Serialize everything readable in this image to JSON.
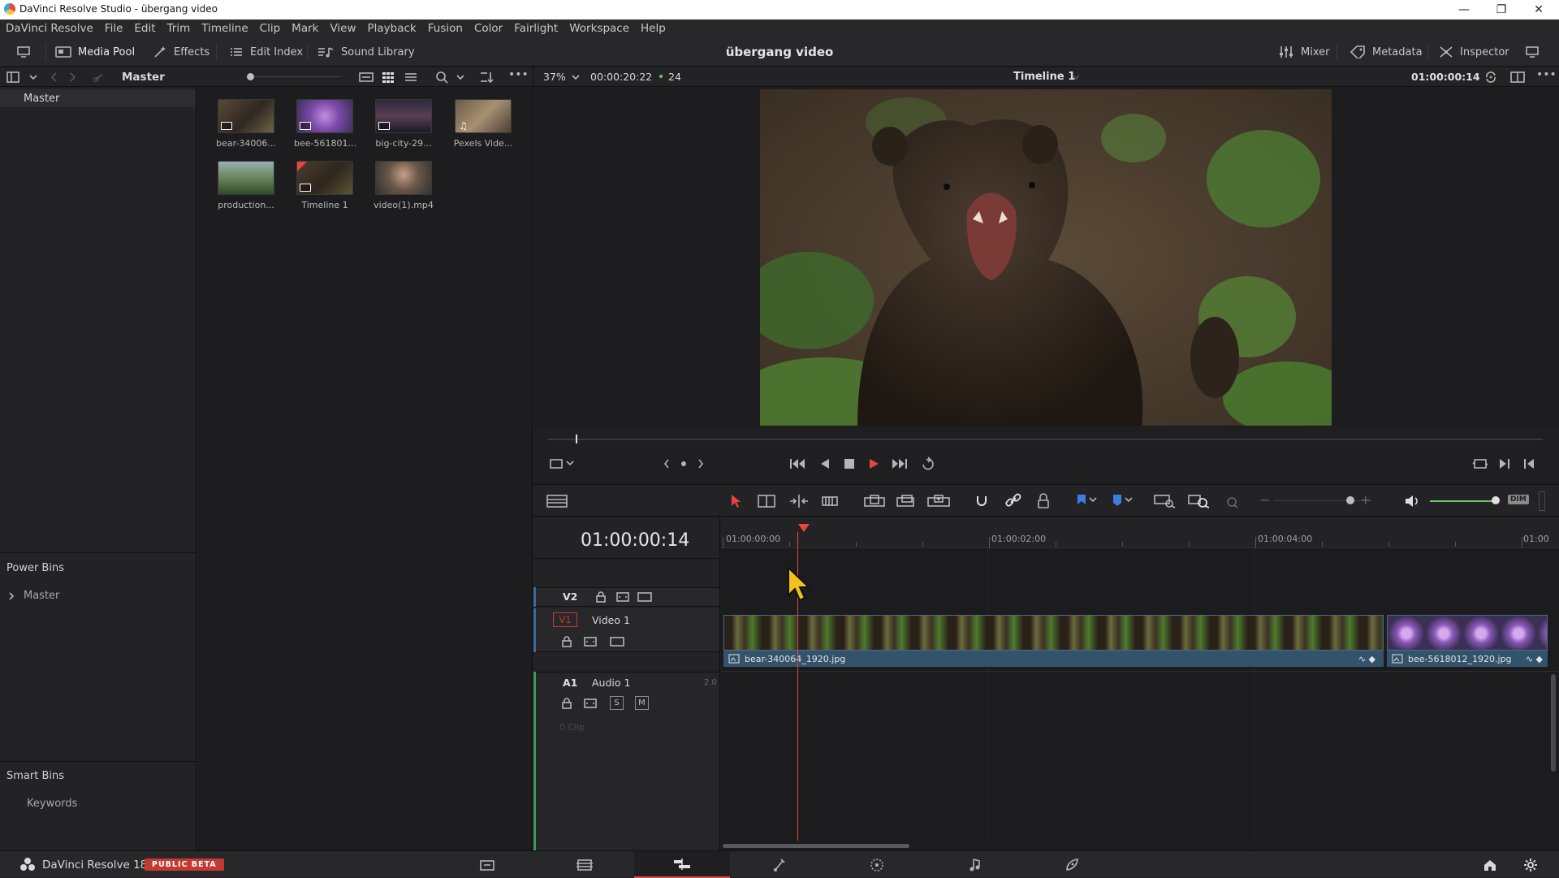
{
  "window": {
    "title": "DaVinci Resolve Studio - übergang video"
  },
  "menu": [
    "DaVinci Resolve",
    "File",
    "Edit",
    "Trim",
    "Timeline",
    "Clip",
    "Mark",
    "View",
    "Playback",
    "Fusion",
    "Color",
    "Fairlight",
    "Workspace",
    "Help"
  ],
  "toolbar": {
    "media_pool": "Media Pool",
    "effects": "Effects",
    "edit_index": "Edit Index",
    "sound_library": "Sound Library",
    "project_title": "übergang video",
    "mixer": "Mixer",
    "metadata": "Metadata",
    "inspector": "Inspector"
  },
  "subbar": {
    "bin": "Master",
    "zoom": "37%",
    "source_timecode": "00:00:20:22",
    "fps": "24",
    "timeline_name": "Timeline 1",
    "record_timecode": "01:00:00:14"
  },
  "left_panel": {
    "master": "Master",
    "power_bins": "Power Bins",
    "power_master": "Master",
    "smart_bins": "Smart Bins",
    "keywords": "Keywords"
  },
  "media_pool": {
    "clips": [
      {
        "name": "bear-34006...",
        "kind": "image"
      },
      {
        "name": "bee-561801...",
        "kind": "image"
      },
      {
        "name": "big-city-29...",
        "kind": "image"
      },
      {
        "name": "Pexels Vide...",
        "kind": "audio"
      },
      {
        "name": "production...",
        "kind": "video"
      },
      {
        "name": "Timeline 1",
        "kind": "timeline"
      },
      {
        "name": "video(1).mp4",
        "kind": "video"
      }
    ]
  },
  "timeline": {
    "timecode": "01:00:00:14",
    "ruler": [
      "01:00:00:00",
      "01:00:02:00",
      "01:00:04:00",
      "01:00"
    ],
    "tracks": {
      "v2": "V2",
      "v1": "V1",
      "v1_name": "Video 1",
      "a1": "A1",
      "a1_name": "Audio 1",
      "a1_channels": "2.0",
      "a1_clips": "0 Clip",
      "solo": "S",
      "mute": "M"
    },
    "clips": [
      {
        "name": "bear-340064_1920.jpg"
      },
      {
        "name": "bee-5618012_1920.jpg"
      }
    ],
    "volume_label": "DIM"
  },
  "bottom": {
    "app": "DaVinci Resolve 18",
    "badge": "PUBLIC BETA"
  },
  "colors": {
    "accent_red": "#e8453c",
    "clip_blue": "#33536c",
    "playhead": "#e8453c"
  }
}
